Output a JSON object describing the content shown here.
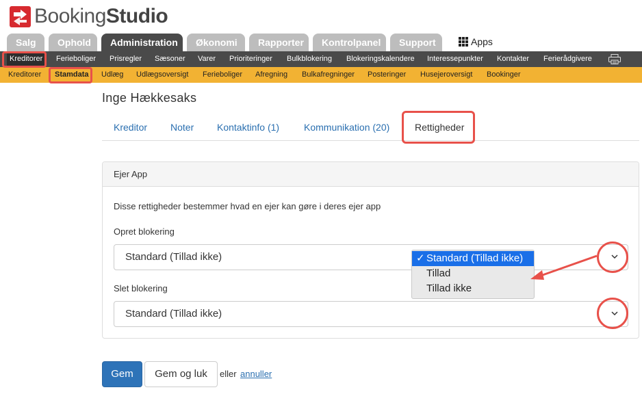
{
  "brand": {
    "name_light": "Booking",
    "name_bold": "Studio",
    "accent": "#d72a2f"
  },
  "main_tabs": [
    {
      "label": "Salg",
      "active": false
    },
    {
      "label": "Ophold",
      "active": false
    },
    {
      "label": "Administration",
      "active": true
    },
    {
      "label": "Økonomi",
      "active": false
    },
    {
      "label": "Rapporter",
      "active": false
    },
    {
      "label": "Kontrolpanel",
      "active": false
    },
    {
      "label": "Support",
      "active": false
    }
  ],
  "apps_label": "Apps",
  "subnav": [
    {
      "label": "Kreditorer",
      "active": true
    },
    {
      "label": "Ferieboliger"
    },
    {
      "label": "Prisregler"
    },
    {
      "label": "Sæsoner"
    },
    {
      "label": "Varer"
    },
    {
      "label": "Prioriteringer"
    },
    {
      "label": "Bulkblokering"
    },
    {
      "label": "Blokeringskalendere"
    },
    {
      "label": "Interessepunkter"
    },
    {
      "label": "Kontakter"
    },
    {
      "label": "Ferierådgivere"
    }
  ],
  "subsubnav": [
    {
      "label": "Kreditorer"
    },
    {
      "label": "Stamdata",
      "active": true
    },
    {
      "label": "Udlæg"
    },
    {
      "label": "Udlægsoversigt"
    },
    {
      "label": "Ferieboliger"
    },
    {
      "label": "Afregning"
    },
    {
      "label": "Bulkafregninger"
    },
    {
      "label": "Posteringer"
    },
    {
      "label": "Husejeroversigt"
    },
    {
      "label": "Bookinger"
    }
  ],
  "person_name": "Inge Hækkesaks",
  "content_tabs": [
    {
      "label": "Kreditor"
    },
    {
      "label": "Noter"
    },
    {
      "label": "Kontaktinfo (1)"
    },
    {
      "label": "Kommunikation (20)"
    },
    {
      "label": "Rettigheder",
      "active": true
    }
  ],
  "panel": {
    "title": "Ejer App",
    "description": "Disse rettigheder bestemmer hvad en ejer kan gøre i deres ejer app",
    "fields": [
      {
        "label": "Opret blokering",
        "value": "Standard (Tillad ikke)"
      },
      {
        "label": "Slet blokering",
        "value": "Standard (Tillad ikke)"
      }
    ]
  },
  "dropdown": {
    "options": [
      "Standard (Tillad ikke)",
      "Tillad",
      "Tillad ikke"
    ],
    "selected_index": 0,
    "check": "✓"
  },
  "actions": {
    "save": "Gem",
    "save_close": "Gem og luk",
    "or": "eller",
    "cancel": "annuller"
  },
  "colors": {
    "nav_dark": "#4a4a4a",
    "nav_yellow": "#f2b233",
    "highlight": "#e8514a",
    "primary": "#2e73b8",
    "link": "#2a6fb0"
  }
}
